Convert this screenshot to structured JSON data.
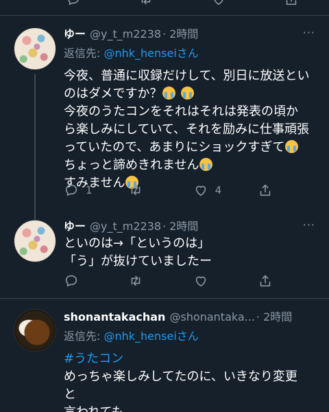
{
  "tweets": [
    {
      "display_name": "ゆー",
      "handle": "@y_t_m2238",
      "time": "· 2時間",
      "reply_to_prefix": "返信先: ",
      "reply_to_user": "@nhk_henseiさん",
      "lines": [
        "今夜、普通に収録だけして、別日に放送とい",
        "のはダメですか？",
        "今夜のうたコンをそれはそれは発表の頃か",
        "ら楽しみにしていて、それを励みに仕事頑張",
        "っていたので、あまりにショックすぎて",
        "ちょっと諦めきれません",
        "すみません"
      ],
      "reply_count": "1",
      "retweet_count": "",
      "like_count": "4"
    },
    {
      "display_name": "ゆー",
      "handle": "@y_t_m2238",
      "time": "· 2時間",
      "lines": [
        "といのは→「というのは」",
        "「う」が抜けていましたー"
      ]
    },
    {
      "display_name": "shonantakachan",
      "handle": "@shonantaka...",
      "time": "· 2時間",
      "reply_to_prefix": "返信先: ",
      "reply_to_user": "@nhk_henseiさん",
      "hashtag": "#うたコン",
      "lines": [
        "めっちゃ楽しみしてたのに、いきなり変更",
        "と",
        "言われても"
      ]
    }
  ],
  "more_label": "···",
  "icons": [
    "reply-icon",
    "retweet-icon",
    "like-icon",
    "share-icon",
    "more-icon"
  ],
  "colors": {
    "background": "#15202b",
    "link": "#1d9bf0",
    "muted": "#8b98a5"
  }
}
